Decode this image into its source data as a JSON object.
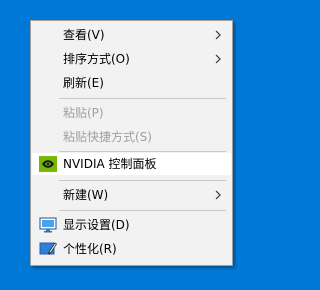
{
  "context_menu": {
    "items": [
      {
        "label": "查看(V)",
        "enabled": true,
        "submenu": true
      },
      {
        "label": "排序方式(O)",
        "enabled": true,
        "submenu": true
      },
      {
        "label": "刷新(E)",
        "enabled": true,
        "submenu": false
      },
      {
        "label": "粘贴(P)",
        "enabled": false,
        "submenu": false
      },
      {
        "label": "粘贴快捷方式(S)",
        "enabled": false,
        "submenu": false
      },
      {
        "label": "NVIDIA 控制面板",
        "enabled": true,
        "submenu": false,
        "icon": "nvidia-icon",
        "highlighted": true
      },
      {
        "label": "新建(W)",
        "enabled": true,
        "submenu": true
      },
      {
        "label": "显示设置(D)",
        "enabled": true,
        "submenu": false,
        "icon": "display-settings-icon"
      },
      {
        "label": "个性化(R)",
        "enabled": true,
        "submenu": false,
        "icon": "personalize-icon"
      }
    ]
  },
  "colors": {
    "desktop_background": "#0078d7",
    "menu_background": "#f2f2f2",
    "disabled_text": "#a0a0a0",
    "nvidia_green": "#76b900"
  }
}
